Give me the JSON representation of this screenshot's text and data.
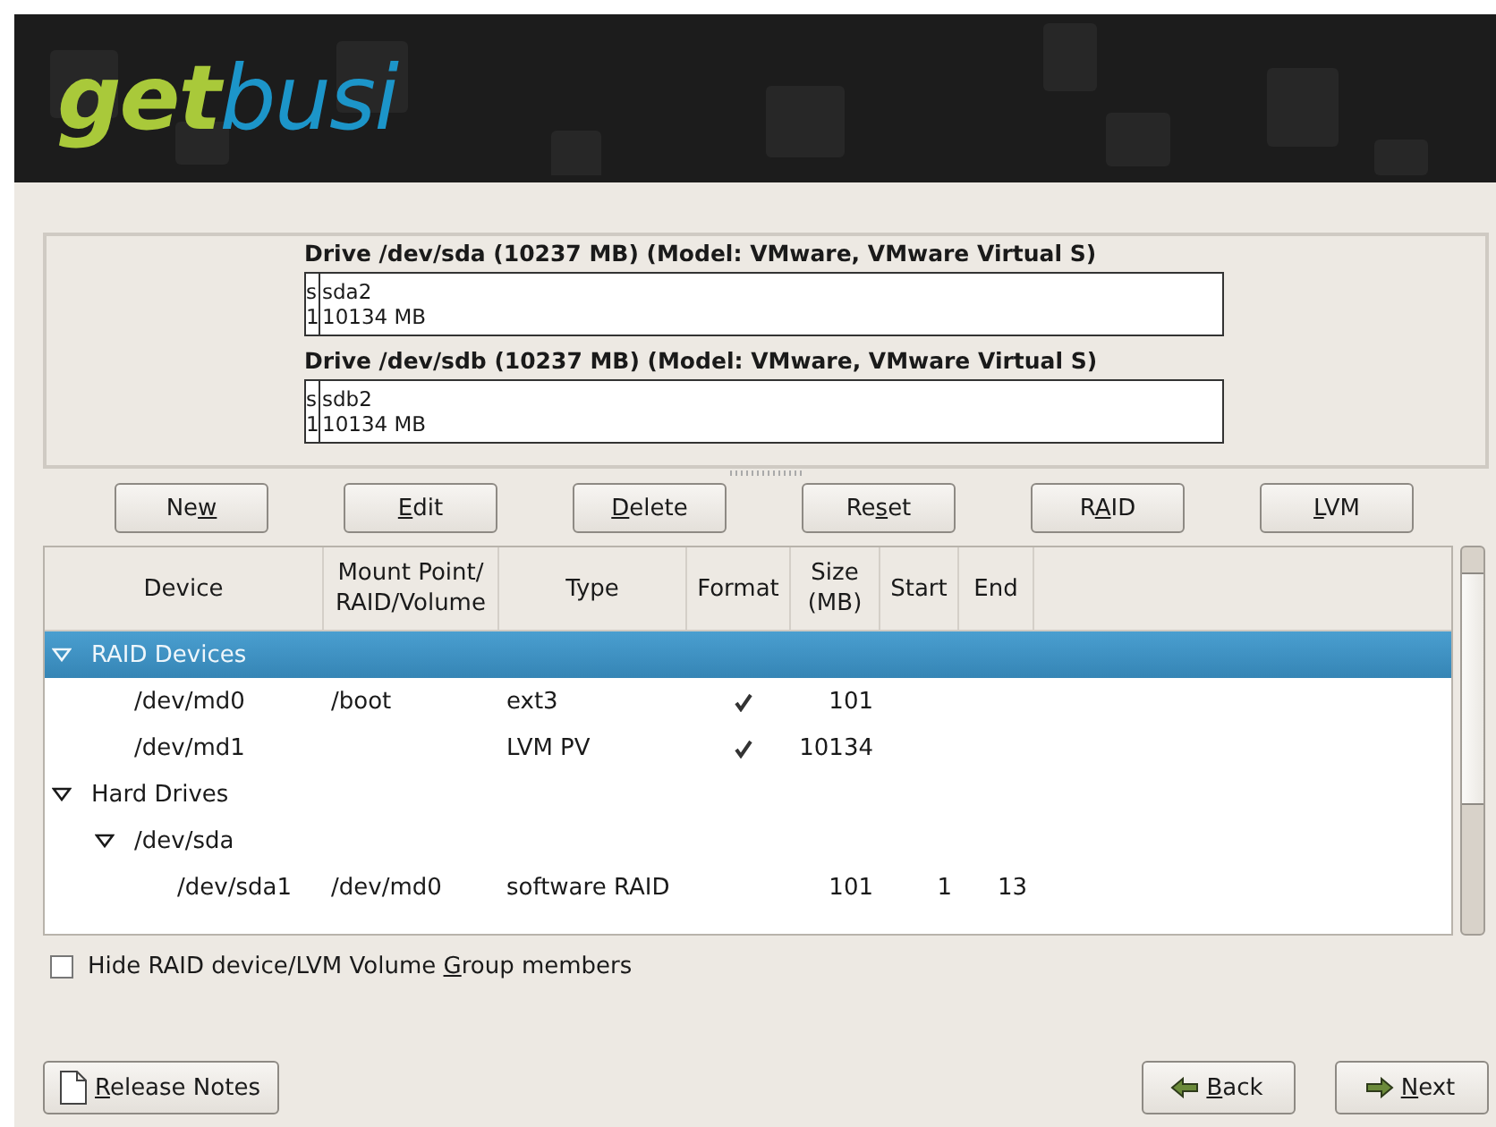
{
  "header": {
    "logo_part1": "get",
    "logo_part2": "busi"
  },
  "drives": [
    {
      "title": "Drive /dev/sda (10237 MB) (Model: VMware, VMware Virtual S)",
      "partitions": [
        {
          "name": "s",
          "size": "1",
          "kind": "sliver"
        },
        {
          "name": "sda2",
          "size": "10134 MB",
          "kind": "main"
        }
      ]
    },
    {
      "title": "Drive /dev/sdb (10237 MB) (Model: VMware, VMware Virtual S)",
      "partitions": [
        {
          "name": "s",
          "size": "1",
          "kind": "sliver"
        },
        {
          "name": "sdb2",
          "size": "10134 MB",
          "kind": "main"
        }
      ]
    }
  ],
  "actions": [
    {
      "before": "Ne",
      "accel": "w"
    },
    {
      "accel": "E",
      "after": "dit"
    },
    {
      "accel": "D",
      "after": "elete"
    },
    {
      "before": "Re",
      "accel": "s",
      "after": "et"
    },
    {
      "before": "R",
      "accel": "A",
      "after": "ID"
    },
    {
      "accel": "L",
      "after": "VM"
    }
  ],
  "table": {
    "columns": [
      "Device",
      "Mount Point/ RAID/Volume",
      "Type",
      "Format",
      "Size (MB)",
      "Start",
      "End"
    ],
    "rows": [
      {
        "device": "RAID Devices",
        "selected": true,
        "expanded": true,
        "children": [
          {
            "device": "/dev/md0",
            "mount": "/boot",
            "type": "ext3",
            "format": true,
            "size": "101",
            "selected": false
          },
          {
            "device": "/dev/md1",
            "type": "LVM PV",
            "format": true,
            "size": "10134",
            "selected": false
          }
        ]
      },
      {
        "device": "Hard Drives",
        "selected": false,
        "expanded": true,
        "children": [
          {
            "device": "/dev/sda",
            "selected": false,
            "expanded": true,
            "children": [
              {
                "device": "/dev/sda1",
                "mount": "/dev/md0",
                "type": "software RAID",
                "format": false,
                "size": "101",
                "start": "1",
                "end": "13",
                "selected": false
              }
            ]
          }
        ]
      }
    ]
  },
  "hide_members": {
    "before": "Hide RAID device/LVM Volume ",
    "accel": "G",
    "after": "roup members",
    "checked": false
  },
  "footer": {
    "release_notes": {
      "accel": "R",
      "after": "elease Notes"
    },
    "back": {
      "accel": "B",
      "after": "ack"
    },
    "next": {
      "accel": "N",
      "after": "ext"
    }
  }
}
